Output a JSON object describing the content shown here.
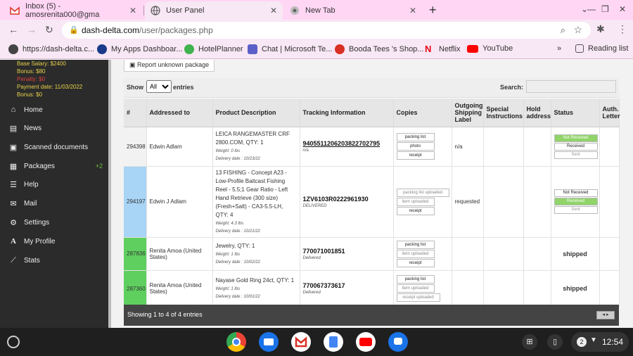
{
  "browser": {
    "tabs": [
      {
        "label": "Inbox (5) - amosrenita000@gma",
        "icon": "gmail-icon"
      },
      {
        "label": "User Panel",
        "icon": "globe-icon"
      },
      {
        "label": "New Tab",
        "icon": "chrome-icon"
      }
    ],
    "new_tab": "+",
    "url_host": "dash-delta.com",
    "url_path": "/user/packages.php"
  },
  "bookmarks": [
    {
      "label": "https://dash-delta.c...",
      "color": "#444444"
    },
    {
      "label": "My Apps Dashboar...",
      "color": "#1a3a8a"
    },
    {
      "label": "HotelPlanner",
      "color": "#3fb34f"
    },
    {
      "label": "Chat | Microsoft Te...",
      "color": "#5b5fc7"
    },
    {
      "label": "Booda Tees 's Shop...",
      "color": "#d93025"
    },
    {
      "label": "Netflix",
      "color": "#e50914"
    },
    {
      "label": "YouTube",
      "color": "#ff0000"
    }
  ],
  "bookmarks_more": "»",
  "reading_list": "Reading list",
  "sidebar": {
    "info": [
      {
        "text": "Base Salary: $2400",
        "color": "#e8d24a"
      },
      {
        "text": "Bonus: $80",
        "color": "#e8d24a"
      },
      {
        "text": "Penalty: $0",
        "color": "#e04040"
      },
      {
        "text": "Payment date: 11/03/2022",
        "color": "#e8d24a"
      },
      {
        "text": "Bonus: $0",
        "color": "#e8d24a"
      }
    ],
    "items": [
      {
        "label": "Home",
        "icon": "home-icon",
        "glyph": "⌂"
      },
      {
        "label": "News",
        "icon": "news-icon",
        "glyph": "▤"
      },
      {
        "label": "Scanned documents",
        "icon": "scanner-icon",
        "glyph": "▣"
      },
      {
        "label": "Packages",
        "icon": "package-icon",
        "glyph": "▦",
        "badge": "+2"
      },
      {
        "label": "Help",
        "icon": "list-icon",
        "glyph": "☰"
      },
      {
        "label": "Mail",
        "icon": "mail-icon",
        "glyph": "✉"
      },
      {
        "label": "Settings",
        "icon": "settings-icon",
        "glyph": "⚙"
      },
      {
        "label": "My Profile",
        "icon": "profile-icon",
        "glyph": "A"
      },
      {
        "label": "Stats",
        "icon": "stats-icon",
        "glyph": "⟋"
      }
    ]
  },
  "main": {
    "report_button": "Report unknown package",
    "show_label": "Show",
    "show_value": "All",
    "entries_label": "entries",
    "search_label": "Search:",
    "columns": [
      "#",
      "Addressed to",
      "Product Description",
      "Tracking Information",
      "Copies",
      "Outgoing Shipping Label",
      "Special Instructions",
      "Hold address",
      "Status",
      "Auth. Letter"
    ],
    "rows": [
      {
        "id": "294398",
        "id_color": "#f2f2f2",
        "addressed": "Edwin Adlam",
        "desc": "LEICA RANGEMASTER CRF 2800.COM, QTY: 1",
        "weight": "Weight: 0 lbs",
        "delivery": "Delivery date : 10/23/22",
        "tracking": "9405511206203822702795",
        "tracking_sub": "n/a",
        "copies": [
          "packing list",
          "photo",
          "receipt"
        ],
        "outgoing": "n/a",
        "status": [
          "Not Received",
          "Received",
          "Sent"
        ]
      },
      {
        "id": "294197",
        "id_color": "#a8d4f5",
        "addressed": "Edwin J Adlam",
        "desc": "13 FISHING - Concept A23 - Low-Profile Baitcast Fishing Reel - 5.5;1 Gear Ratio - Left Hand Retrieve (300 size) (Fresh+Salt) - CA3-5.5-LH, QTY: 4",
        "weight": "Weight: 4.3 lbs",
        "delivery": "Delivery date : 10/21/22",
        "tracking": "1ZV6103R0222961930",
        "tracking_sub": "DELIVERED",
        "copies": [
          "packing list uploaded",
          "item uploaded",
          "receipt"
        ],
        "outgoing": "requested",
        "status": [
          "Not Received",
          "Received",
          "Sent"
        ]
      },
      {
        "id": "287836",
        "id_color": "#5fcf5f",
        "addressed": "Renita Amoa (United States)",
        "desc": "Jewelry, QTY: 1",
        "weight": "Weight: 1 lbs",
        "delivery": "Delivery date : 10/02/22",
        "tracking": "770071001851",
        "tracking_sub": "Delivered",
        "copies": [
          "packing list",
          "item uploaded",
          "receipt"
        ],
        "outgoing": "",
        "status_text": "shipped"
      },
      {
        "id": "287360",
        "id_color": "#5fcf5f",
        "addressed": "Renita Amoa (United States)",
        "desc": "Nayase Gold Ring 24ct, QTY: 1",
        "weight": "Weight: 1 lbs",
        "delivery": "Delivery date : 10/01/22",
        "tracking": "770067373617",
        "tracking_sub": "Delivered",
        "copies": [
          "packing list",
          "item uploaded",
          "receipt uploaded"
        ],
        "outgoing": "",
        "status_text": "shipped"
      }
    ],
    "footer_info": "Showing 1 to 4 of 4 entries"
  },
  "shelf": {
    "apps": [
      {
        "name": "chrome-app-icon",
        "color": "#4285f4"
      },
      {
        "name": "files-app-icon",
        "color": "#1a73e8"
      },
      {
        "name": "gmail-app-icon",
        "color": "#ffffff"
      },
      {
        "name": "docs-app-icon",
        "color": "#4285f4"
      },
      {
        "name": "youtube-app-icon",
        "color": "#ff0000"
      },
      {
        "name": "messages-app-icon",
        "color": "#1a73e8"
      }
    ],
    "notification_count": "2",
    "time": "12:54"
  }
}
